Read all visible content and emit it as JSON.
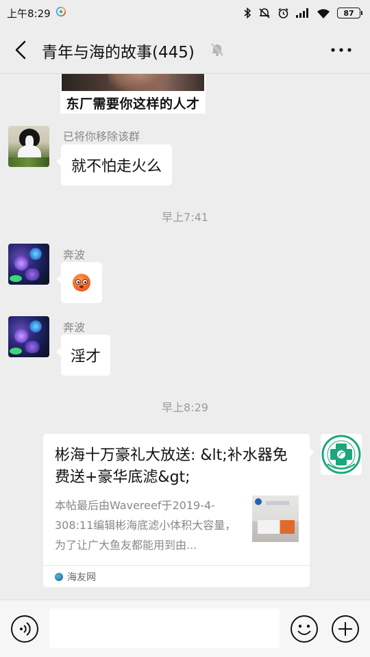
{
  "status_bar": {
    "time": "上午8:29",
    "battery": "87"
  },
  "header": {
    "title": "青年与海的故事(445)",
    "icons": [
      "back-icon",
      "mute-bell-icon",
      "more-icon"
    ]
  },
  "messages": {
    "sticker_caption": "东厂需要你这样的人才",
    "msg1": {
      "sender": "已将你移除该群",
      "text": "就不怕走火么"
    },
    "time1": "早上7:41",
    "msg2": {
      "sender": "奔波",
      "emoji": "flushed-face-emoji"
    },
    "msg3": {
      "sender": "奔波",
      "text": "淫才"
    },
    "time2": "早上8:29",
    "link_card": {
      "title": "彬海十万豪礼大放送: &lt;补水器免费送+豪华底滤&gt;",
      "description": "本帖最后由Wavereef于2019-4-308:11编辑彬海底滤小体积大容量，为了让广大鱼友都能用到由...",
      "source": "海友网"
    }
  },
  "input_bar": {
    "placeholder": "",
    "icons": [
      "voice-icon",
      "emoji-icon",
      "plus-icon"
    ]
  }
}
